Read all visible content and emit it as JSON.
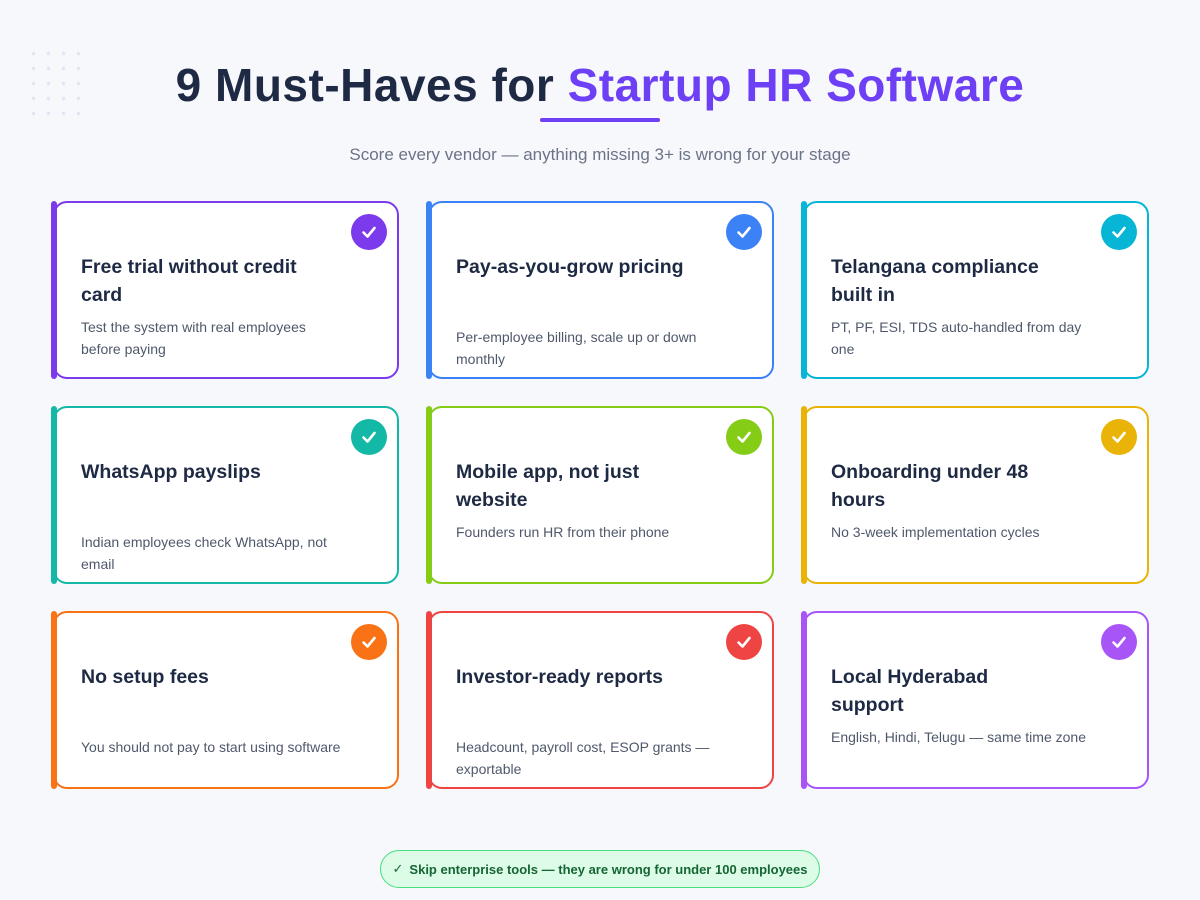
{
  "header": {
    "title_prefix": "9 Must-Haves for ",
    "title_accent": "Startup HR Software",
    "subtitle": "Score every vendor — anything missing 3+ is wrong for your stage"
  },
  "accent_color": "#6d3ff5",
  "cards": [
    {
      "title": "Free trial without credit card",
      "description": "Test the system with real employees before paying",
      "color": "#7c3aed",
      "icon": "check-icon"
    },
    {
      "title": "Pay-as-you-grow pricing",
      "description": "Per-employee billing, scale up or down monthly",
      "color": "#3b82f6",
      "icon": "check-icon"
    },
    {
      "title": "Telangana compliance built in",
      "description": "PT, PF, ESI, TDS auto-handled from day one",
      "color": "#06b6d4",
      "icon": "check-icon"
    },
    {
      "title": "WhatsApp payslips",
      "description": "Indian employees check WhatsApp, not email",
      "color": "#14b8a6",
      "icon": "check-icon"
    },
    {
      "title": "Mobile app, not just website",
      "description": "Founders run HR from their phone",
      "color": "#84cc16",
      "icon": "check-icon"
    },
    {
      "title": "Onboarding under 48 hours",
      "description": "No 3-week implementation cycles",
      "color": "#eab308",
      "icon": "check-icon"
    },
    {
      "title": "No setup fees",
      "description": "You should not pay to start using software",
      "color": "#f97316",
      "icon": "check-icon"
    },
    {
      "title": "Investor-ready reports",
      "description": "Headcount, payroll cost, ESOP grants — exportable",
      "color": "#ef4444",
      "icon": "check-icon"
    },
    {
      "title": "Local Hyderabad support",
      "description": "English, Hindi, Telugu — same time zone",
      "color": "#a855f7",
      "icon": "check-icon"
    }
  ],
  "footer": {
    "icon": "check-icon",
    "check_glyph": "✓",
    "text": "Skip enterprise tools — they are wrong for under 100 employees",
    "color": "#4ade80"
  }
}
